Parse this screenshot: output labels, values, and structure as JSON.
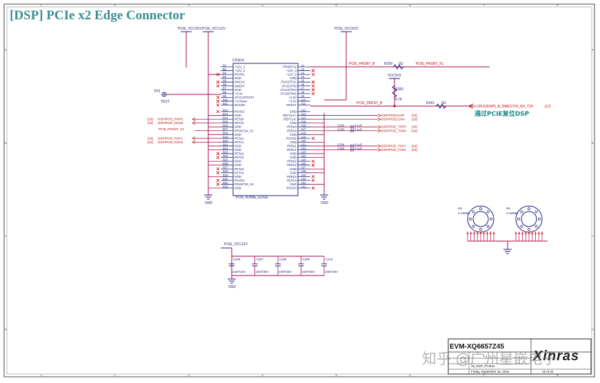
{
  "title": "[DSP] PCIe x2 Edge Connector",
  "colors": {
    "wire": "#b0004a",
    "part": "#1b1b7a",
    "text": "#1b1b7a",
    "net": "#c40000",
    "title": "#3b8f8f",
    "ground": "#1b1b7a"
  },
  "power": {
    "pcie_vcc3v3": "PCIE_VCC3V3",
    "pcie_vcc12v": "PCIE_VCC12V",
    "vcc3v3": "VCC3V3",
    "pcie_vcc12v_caps": "PCIE_VCC12V"
  },
  "connector": {
    "designator": "CON14",
    "part": "PCIe_4LANE_EDGE",
    "left_pins": [
      {
        "num": "B1",
        "name": "+12V_1"
      },
      {
        "num": "B2",
        "name": "+12V_2"
      },
      {
        "num": "B3",
        "name": "RSVD1"
      },
      {
        "num": "B4",
        "name": "GND"
      },
      {
        "num": "B5",
        "name": "SMCLK"
      },
      {
        "num": "B6",
        "name": "SMDAT"
      },
      {
        "num": "B7",
        "name": "GND"
      },
      {
        "num": "B8",
        "name": "+3.3V"
      },
      {
        "num": "B9",
        "name": "JTAG1/TRST#"
      },
      {
        "num": "B10",
        "name": "+3.3Vaux"
      },
      {
        "num": "B11",
        "name": "WAKE#"
      },
      {
        "num": "B12",
        "name": "RSVD2"
      },
      {
        "num": "B13",
        "name": "GND"
      },
      {
        "num": "B14",
        "name": "PETp0"
      },
      {
        "num": "B15",
        "name": "PETn0"
      },
      {
        "num": "B16",
        "name": "GND"
      },
      {
        "num": "B17",
        "name": "PRSNT2#_X1"
      },
      {
        "num": "B18",
        "name": "GND"
      },
      {
        "num": "B19",
        "name": "PETp1"
      },
      {
        "num": "B20",
        "name": "PETn1"
      },
      {
        "num": "B21",
        "name": "GND"
      },
      {
        "num": "B22",
        "name": "GND"
      },
      {
        "num": "B23",
        "name": "PETp2"
      },
      {
        "num": "B24",
        "name": "PETn2"
      },
      {
        "num": "B25",
        "name": "GND"
      },
      {
        "num": "B26",
        "name": "GND"
      },
      {
        "num": "B27",
        "name": "PETp3"
      },
      {
        "num": "B28",
        "name": "PETn3"
      },
      {
        "num": "B29",
        "name": "GND"
      },
      {
        "num": "B30",
        "name": "RSVD3"
      },
      {
        "num": "B31",
        "name": "PRSNT2#_X4"
      },
      {
        "num": "B32",
        "name": "GND"
      }
    ],
    "right_pins": [
      {
        "num": "A1",
        "name": "PRSNT1#"
      },
      {
        "num": "A2",
        "name": "+12V_4"
      },
      {
        "num": "A3",
        "name": "+12V_5"
      },
      {
        "num": "A4",
        "name": "GND"
      },
      {
        "num": "A5",
        "name": "JTAG2/TCK"
      },
      {
        "num": "A6",
        "name": "JTAG3/TDI"
      },
      {
        "num": "A7",
        "name": "JTAG4/TDO"
      },
      {
        "num": "A8",
        "name": "JTAG5/TMS"
      },
      {
        "num": "A9",
        "name": "+3.3V"
      },
      {
        "num": "A10",
        "name": "+3.3V"
      },
      {
        "num": "A11",
        "name": "PERST"
      },
      {
        "num": "A12",
        "name": "GND"
      },
      {
        "num": "A13",
        "name": "REFCLK+"
      },
      {
        "num": "A14",
        "name": "REFCLK-"
      },
      {
        "num": "A15",
        "name": "GND"
      },
      {
        "num": "A16",
        "name": "PERp0"
      },
      {
        "num": "A17",
        "name": "PERn0"
      },
      {
        "num": "A18",
        "name": "GND"
      },
      {
        "num": "A19",
        "name": "RSVD5"
      },
      {
        "num": "A20",
        "name": "GND"
      },
      {
        "num": "A21",
        "name": "PERp1"
      },
      {
        "num": "A22",
        "name": "PERn1"
      },
      {
        "num": "A23",
        "name": "GND"
      },
      {
        "num": "A24",
        "name": "GND"
      },
      {
        "num": "A25",
        "name": "PERp2"
      },
      {
        "num": "A26",
        "name": "PERn2"
      },
      {
        "num": "A27",
        "name": "GND"
      },
      {
        "num": "A28",
        "name": "GND"
      },
      {
        "num": "A29",
        "name": "PERp3"
      },
      {
        "num": "A30",
        "name": "PERn3"
      },
      {
        "num": "A31",
        "name": "GND"
      },
      {
        "num": "A32",
        "name": "RSVD4"
      }
    ]
  },
  "left_nets": [
    {
      "ref": "[19]",
      "label": "DSP/PCIE_RXP0"
    },
    {
      "ref": "[19]",
      "label": "DSP/PCIE_RXN0"
    },
    {
      "ref": "",
      "label": "PCIE_PRSNT_X1"
    },
    {
      "ref": "[19]",
      "label": "DSP/PCIE_RXP1"
    },
    {
      "ref": "[19]",
      "label": "DSP/PCIE_RXN1"
    }
  ],
  "right_nets": [
    {
      "label": "DSP/PCIECLKP",
      "ref": "[19]"
    },
    {
      "label": "DSP/PCIECLKN",
      "ref": "[19]"
    },
    {
      "label": "DSP/PCIE_TXP0",
      "ref": "[19]"
    },
    {
      "label": "DSP/PCIE_TXN0",
      "ref": "[19]"
    },
    {
      "label": "DSP/PCIE_TXP1",
      "ref": "[19]"
    },
    {
      "label": "DSP/PCIE_TXN1",
      "ref": "[19]"
    }
  ],
  "coupling_caps": [
    {
      "ref": "C202",
      "value": "0.1uF"
    },
    {
      "ref": "C203",
      "value": "0.1uF"
    },
    {
      "ref": "C204",
      "value": "0.1uF"
    },
    {
      "ref": "C205",
      "value": "0.1uF"
    }
  ],
  "nets_top": {
    "prsnt_b": "PCIE_PRSNT_B",
    "r259": "R259",
    "r259_val": "0Ω",
    "prsnt_x1": "PCIE_PRSNT_X1",
    "perst_b": "PCIE_PERST_B",
    "r260": "R260",
    "r260_val": "4.7K",
    "r261": "R261",
    "r261_val": "0Ω",
    "cpld": "CPLD/DSP0_B_DIRECTIO_RX_T1P",
    "cpld_ref": "[17]",
    "note_cn": "通过PCIE复位DSP"
  },
  "testpoint": {
    "ref": "TP3",
    "label": "TEST"
  },
  "gnd_label": "GND",
  "bulk_caps": [
    {
      "ref": "C206",
      "value": "22uF/16V"
    },
    {
      "ref": "C207",
      "value": "10nF/25V"
    },
    {
      "ref": "C208",
      "value": "10nF/25V"
    },
    {
      "ref": "C209",
      "value": "10nF/25V"
    },
    {
      "ref": "C210",
      "value": "10nF/25V"
    }
  ],
  "mounting_holes": [
    {
      "ref": "H5",
      "size": "3.18MM"
    },
    {
      "ref": "H6",
      "size": "3.18MM"
    }
  ],
  "title_block": {
    "project": "EVM-XQ6657Z45",
    "brand": "Xinras",
    "sheet_name": "15_DSP_PCIEx2",
    "date": "Friday, September 16, 2022",
    "sheet_of": "15 of 20",
    "rev": "A"
  },
  "watermark": "知乎 @广州星嵌电子",
  "border_rows": [
    "A",
    "B",
    "C",
    "D"
  ],
  "border_cols": [
    "1",
    "2",
    "3",
    "4",
    "5",
    "6",
    "7",
    "8"
  ]
}
